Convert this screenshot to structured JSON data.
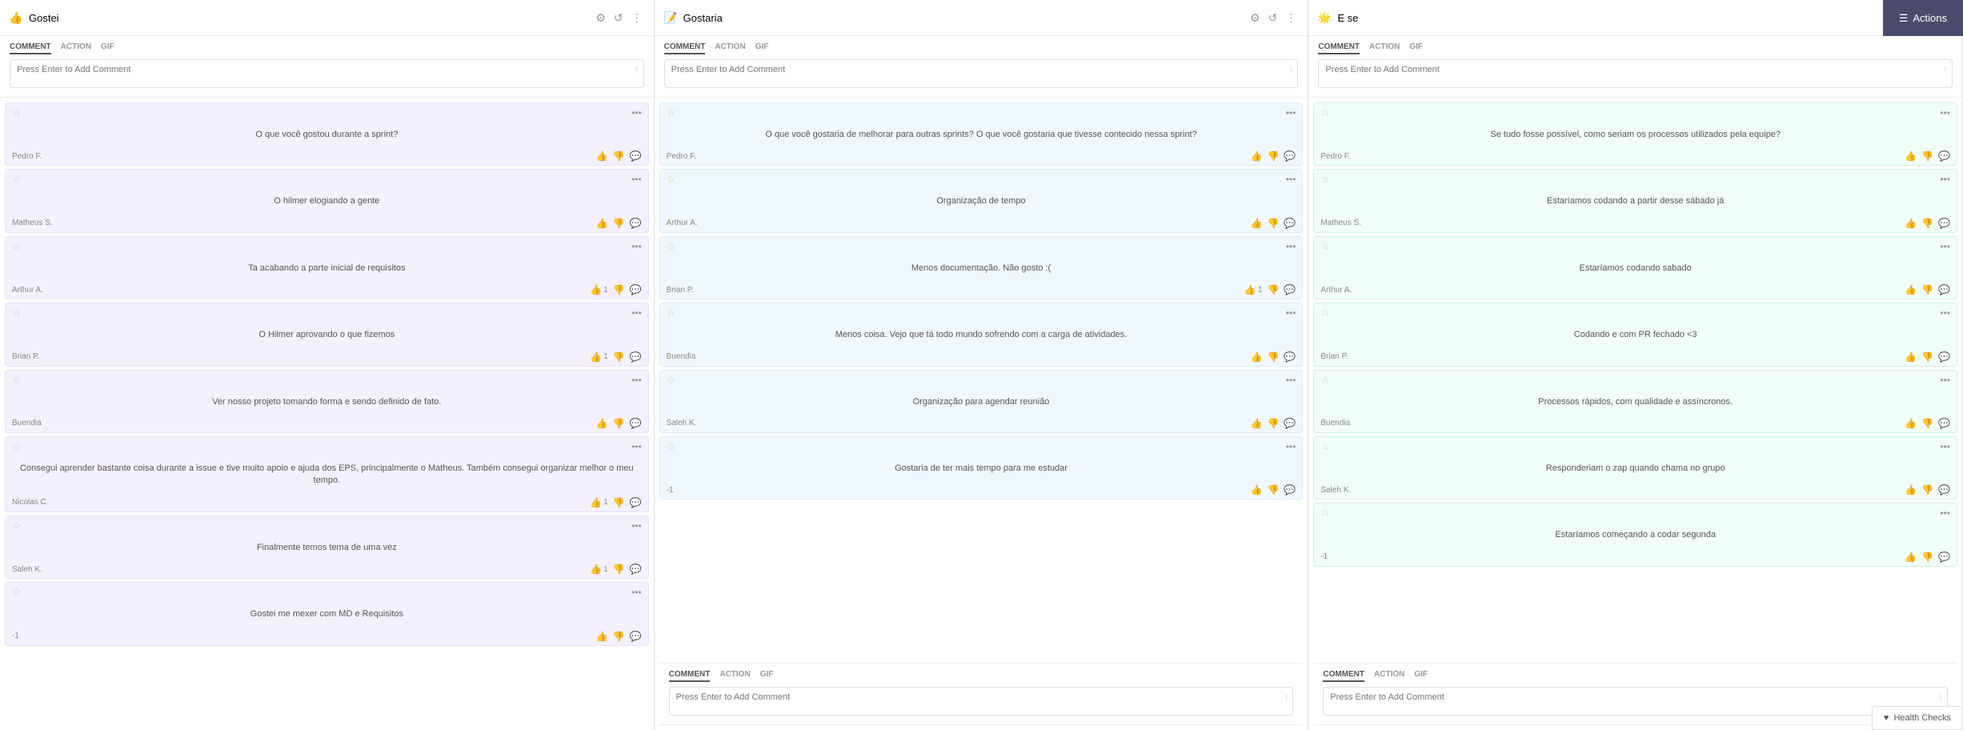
{
  "columns": [
    {
      "id": "col1",
      "icon": "👍",
      "title": "Gostei",
      "color": "purple",
      "commentTabs": [
        "COMMENT",
        "ACTION",
        "GIF"
      ],
      "commentPlaceholder": "Press Enter to Add Comment",
      "cards": [
        {
          "id": 1,
          "starred": false,
          "text": "O que você gostou durante a sprint?",
          "author": "Pedro F.",
          "likes": 0,
          "dislikes": 0,
          "comments": 0
        },
        {
          "id": 2,
          "starred": false,
          "text": "O hilmer elogiando a gente",
          "author": "Matheus S.",
          "likes": 0,
          "dislikes": 0,
          "comments": 0
        },
        {
          "id": 3,
          "starred": false,
          "text": "Ta acabando a parte inicial de requisitos",
          "author": "Arthur A.",
          "likes": 1,
          "dislikes": 0,
          "comments": 0
        },
        {
          "id": 4,
          "starred": false,
          "text": "O Hilmer aprovando o que fizemos",
          "author": "Brian P.",
          "likes": 1,
          "dislikes": 0,
          "comments": 0
        },
        {
          "id": 5,
          "starred": false,
          "text": "Ver nosso projeto tomando forma e sendo definido de fato.",
          "author": "Buendia",
          "likes": 0,
          "dislikes": 0,
          "comments": 0
        },
        {
          "id": 6,
          "starred": false,
          "text": "Consegui aprender bastante coisa durante a issue e tive muito apoio e ajuda dos EPS, principalmente o Matheus. Também consegui organizar melhor o meu tempo.",
          "author": "Nicolas C.",
          "likes": 1,
          "dislikes": 0,
          "comments": 0
        },
        {
          "id": 7,
          "starred": false,
          "text": "Finalmente temos tema de uma vez",
          "author": "Saleh K.",
          "likes": 1,
          "dislikes": 0,
          "comments": 0
        },
        {
          "id": 8,
          "starred": false,
          "text": "Gostei me mexer com MD e Requisitos",
          "author": "",
          "likes": 0,
          "negative": -1,
          "comments": 0
        }
      ]
    },
    {
      "id": "col2",
      "icon": "📝",
      "title": "Gostaria",
      "color": "blue",
      "commentTabs": [
        "COMMENT",
        "ACTION",
        "GIF"
      ],
      "commentPlaceholder": "Press Enter to Add Comment",
      "commentPlaceholder2": "Press Enter to Add Comment",
      "cards": [
        {
          "id": 1,
          "starred": false,
          "text": "O que você gostaria de melhorar para outras sprints? O que você gostaria que tivesse contecido nessa sprint?",
          "author": "Pedro F.",
          "likes": 0,
          "dislikes": 0,
          "comments": 0
        },
        {
          "id": 2,
          "starred": false,
          "text": "Organização de tempo",
          "author": "Arthur A.",
          "likes": 0,
          "dislikes": 0,
          "comments": 0
        },
        {
          "id": 3,
          "starred": false,
          "text": "Menos documentação. Não gosto :(",
          "author": "Brian P.",
          "likes": 1,
          "dislikes": 0,
          "comments": 0
        },
        {
          "id": 4,
          "starred": false,
          "text": "Menos coisa. Vejo que tá todo mundo sofrendo com a carga de atividades.",
          "author": "Buendia",
          "likes": 0,
          "dislikes": 0,
          "comments": 0
        },
        {
          "id": 5,
          "starred": false,
          "text": "Organização para agendar reunião",
          "author": "Saleh K.",
          "likes": 0,
          "dislikes": 0,
          "comments": 0
        },
        {
          "id": 6,
          "starred": false,
          "text": "Gostaria de ter mais tempo para me estudar",
          "author": "",
          "negative": -1,
          "likes": 0,
          "dislikes": 0,
          "comments": 0
        }
      ]
    },
    {
      "id": "col3",
      "icon": "🌟",
      "title": "E se",
      "color": "green",
      "commentTabs": [
        "COMMENT",
        "ACTION",
        "GIF"
      ],
      "commentPlaceholder": "Press Enter to Add Comment",
      "cards": [
        {
          "id": 1,
          "starred": false,
          "text": "Se tudo fosse possível, como seriam os processos utilizados pela equipe?",
          "author": "Pedro F.",
          "likes": 0,
          "dislikes": 0,
          "comments": 0
        },
        {
          "id": 2,
          "starred": false,
          "text": "Estaríamos codando a partir desse sábado já",
          "author": "Matheus S.",
          "likes": 0,
          "dislikes": 0,
          "comments": 0
        },
        {
          "id": 3,
          "starred": false,
          "text": "Estaríamos codando sabado",
          "author": "Arthur A.",
          "likes": 0,
          "dislikes": 0,
          "comments": 0
        },
        {
          "id": 4,
          "starred": false,
          "text": "Codando e com PR fechado <3",
          "author": "Brian P.",
          "likes": 0,
          "dislikes": 0,
          "comments": 0
        },
        {
          "id": 5,
          "starred": false,
          "text": "Processos rápidos, com qualidade e assíncronos.",
          "author": "Buendia",
          "likes": 0,
          "dislikes": 0,
          "comments": 0
        },
        {
          "id": 6,
          "starred": false,
          "text": "Responderiam o zap quando chama no grupo",
          "author": "Saleh K.",
          "likes": 0,
          "dislikes": 0,
          "comments": 0
        },
        {
          "id": 7,
          "starred": false,
          "text": "Estaríamos começando a codar segunda",
          "author": "",
          "negative": -1,
          "likes": 0,
          "dislikes": 0,
          "comments": 0
        }
      ]
    }
  ],
  "actionsButton": {
    "label": "Actions",
    "icon": "☰"
  },
  "healthChecks": {
    "label": "Health Checks",
    "icon": "♥"
  }
}
